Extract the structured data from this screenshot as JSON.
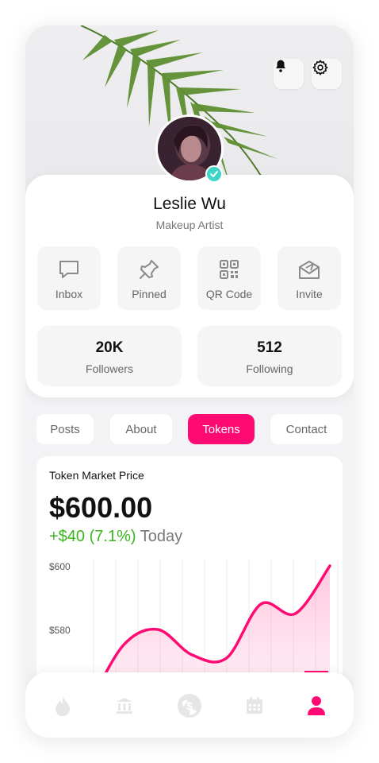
{
  "header": {
    "bell_icon": "bell-icon",
    "settings_icon": "gear-icon"
  },
  "profile": {
    "name": "Leslie Wu",
    "role": "Makeup Artist",
    "verified": true
  },
  "actions": [
    {
      "label": "Inbox",
      "icon": "chat-bubble-icon"
    },
    {
      "label": "Pinned",
      "icon": "pin-icon"
    },
    {
      "label": "QR Code",
      "icon": "qr-code-icon"
    },
    {
      "label": "Invite",
      "icon": "envelope-icon"
    }
  ],
  "stats": [
    {
      "value": "20K",
      "label": "Followers"
    },
    {
      "value": "512",
      "label": "Following"
    }
  ],
  "tabs": [
    {
      "label": "Posts",
      "active": false
    },
    {
      "label": "About",
      "active": false
    },
    {
      "label": "Tokens",
      "active": true
    },
    {
      "label": "Contact",
      "active": false
    }
  ],
  "token": {
    "title": "Token Market Price",
    "price": "$600.00",
    "change": "+$40 (7.1%)",
    "period": "Today"
  },
  "chart_data": {
    "type": "area",
    "y_ticks": [
      "$600",
      "$580"
    ],
    "ylim": [
      560,
      600
    ],
    "grid": true,
    "series": [
      {
        "values": [
          556,
          575,
          580,
          572,
          571,
          588,
          585,
          600
        ]
      }
    ],
    "line_color": "#ff0a72"
  },
  "bottom_nav": [
    {
      "icon": "fire-icon",
      "active": false
    },
    {
      "icon": "bank-icon",
      "active": false
    },
    {
      "icon": "globe-dollar-icon",
      "active": false
    },
    {
      "icon": "calendar-icon",
      "active": false
    },
    {
      "icon": "user-icon",
      "active": true
    }
  ],
  "colors": {
    "accent": "#ff0a72",
    "positive": "#3ab61d",
    "verified": "#3fd4c8"
  }
}
